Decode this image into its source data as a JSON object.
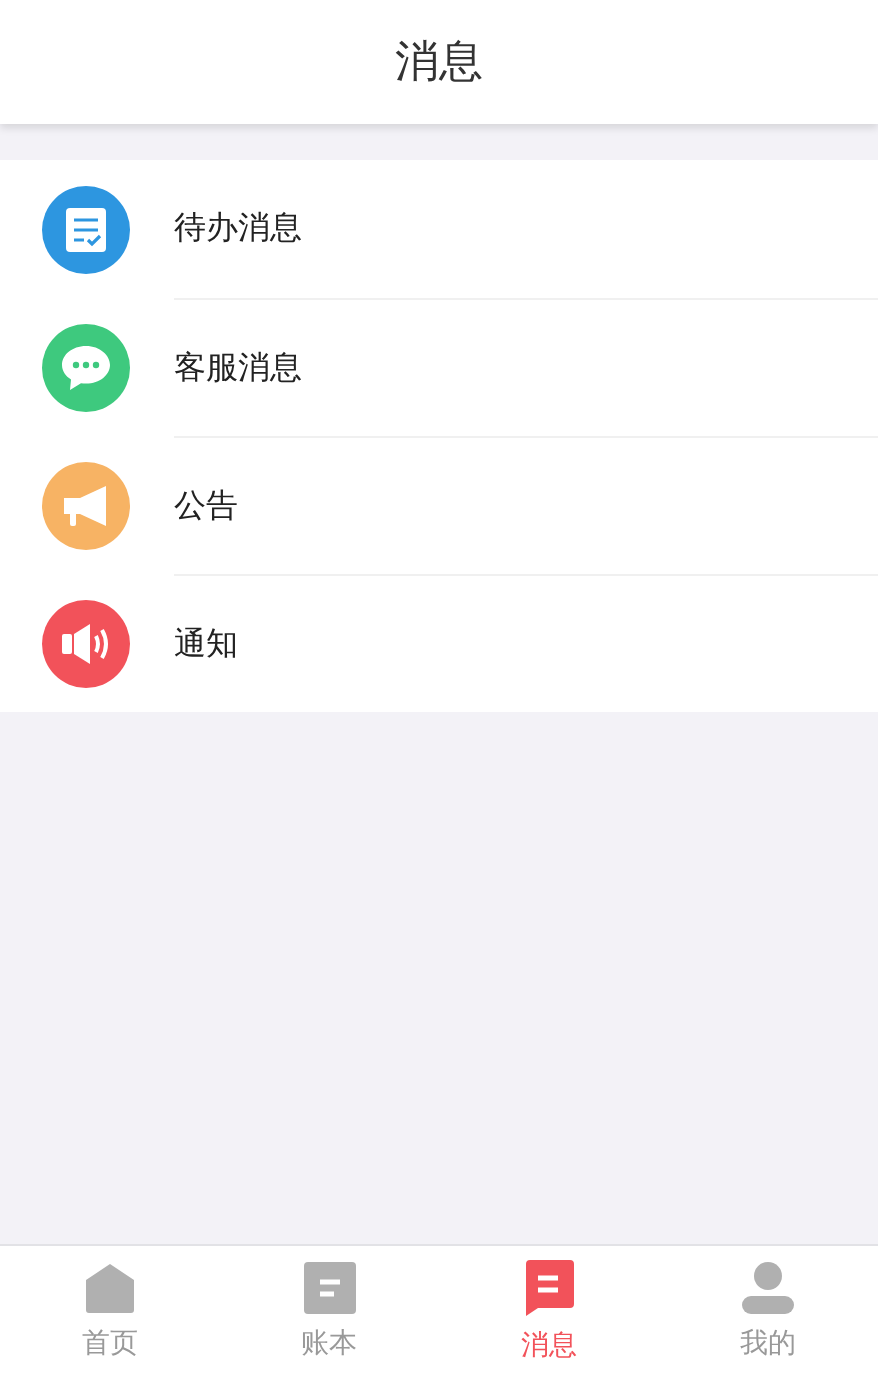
{
  "header": {
    "title": "消息"
  },
  "items": [
    {
      "label": "待办消息",
      "kind": "todo",
      "color": "#2d96e0"
    },
    {
      "label": "客服消息",
      "kind": "chat",
      "color": "#3ec97e"
    },
    {
      "label": "公告",
      "kind": "announce",
      "color": "#f7b364"
    },
    {
      "label": "通知",
      "kind": "notify",
      "color": "#f2525a"
    }
  ],
  "tabs": [
    {
      "label": "首页",
      "kind": "home",
      "selected": false
    },
    {
      "label": "账本",
      "kind": "ledger",
      "selected": false
    },
    {
      "label": "消息",
      "kind": "message",
      "selected": true
    },
    {
      "label": "我的",
      "kind": "profile",
      "selected": false
    }
  ]
}
